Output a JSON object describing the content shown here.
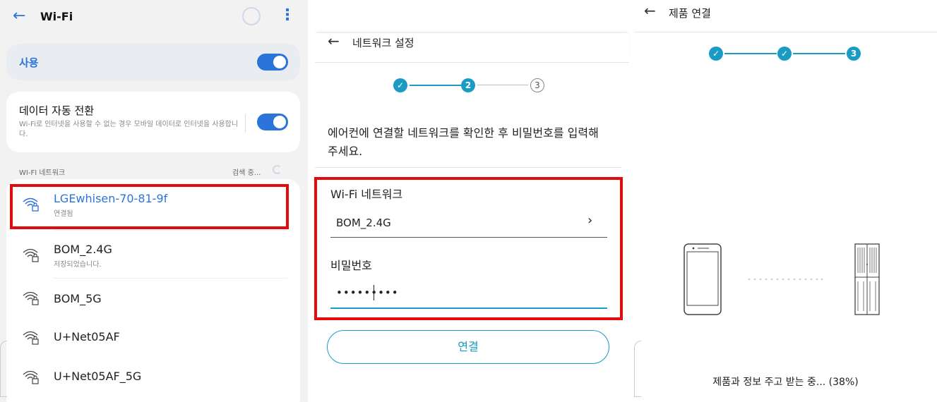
{
  "wifi_screen": {
    "title": "Wi-Fi",
    "use_label": "사용",
    "auto_switch": {
      "title": "데이터 자동 전환",
      "description": "Wi-Fi로 인터넷을 사용할 수 없는 경우 모바일 데이터로 인터넷을 사용합니다."
    },
    "section_label": "WI-FI 네트워크",
    "scanning_label": "검색 중...",
    "networks": [
      {
        "name": "LGEwhisen-70-81-9f",
        "status": "연결됨",
        "highlighted": true
      },
      {
        "name": "BOM_2.4G",
        "status": "저장되었습니다."
      },
      {
        "name": "BOM_5G",
        "status": ""
      },
      {
        "name": "U+Net05AF",
        "status": ""
      },
      {
        "name": "U+Net05AF_5G",
        "status": ""
      }
    ],
    "accent_color": "#2b74d9"
  },
  "network_setup_screen": {
    "title": "네트워크 설정",
    "steps": [
      {
        "label": "✓",
        "state": "done"
      },
      {
        "label": "2",
        "state": "current"
      },
      {
        "label": "3",
        "state": "pending"
      }
    ],
    "instruction": "에어컨에 연결할 네트워크를 확인한 후 비밀번호를 입력해 주세요.",
    "wifi_label": "Wi-Fi 네트워크",
    "wifi_value": "BOM_2.4G",
    "password_label": "비밀번호",
    "password_value": "•••••••••",
    "connect_button": "연결",
    "accent_color": "#1a9bc4",
    "highlight_color": "#e20a0a"
  },
  "product_connect_screen": {
    "title": "제품 연결",
    "steps": [
      {
        "label": "✓",
        "state": "done"
      },
      {
        "label": "✓",
        "state": "done"
      },
      {
        "label": "3",
        "state": "current"
      }
    ],
    "status_text": "제품과 정보 주고 받는 중... (38%)",
    "progress_percent": 38
  }
}
